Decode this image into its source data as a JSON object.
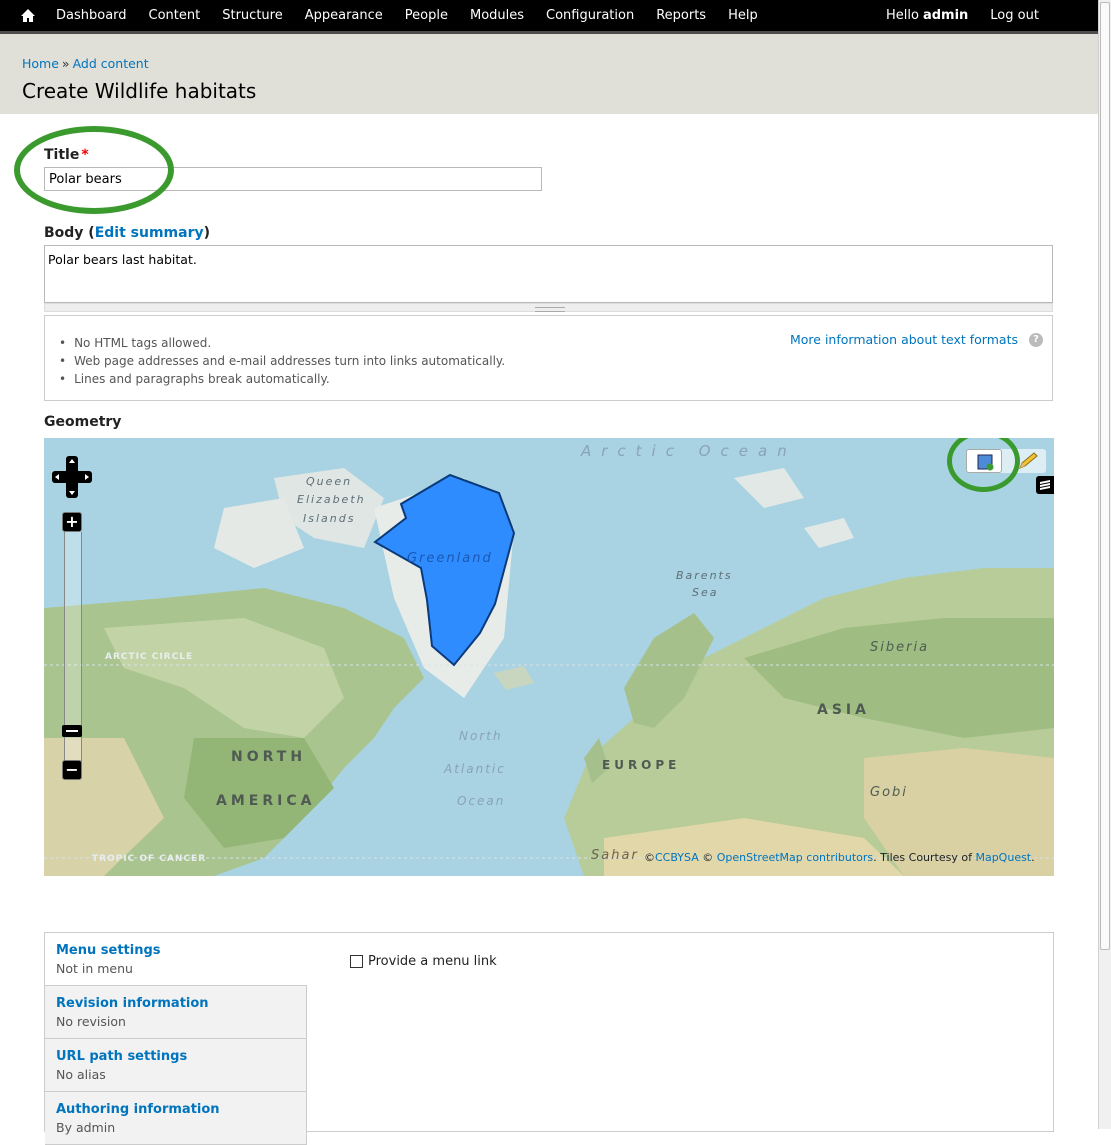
{
  "toolbar": {
    "menu": [
      "Dashboard",
      "Content",
      "Structure",
      "Appearance",
      "People",
      "Modules",
      "Configuration",
      "Reports",
      "Help"
    ],
    "greeting": "Hello",
    "username": "admin",
    "logout": "Log out"
  },
  "header": {
    "breadcrumb": [
      "Home",
      "Add content"
    ],
    "breadcrumb_sep": "»",
    "title": "Create Wildlife habitats"
  },
  "form": {
    "title_label": "Title",
    "required_mark": "*",
    "title_value": "Polar bears",
    "body_label": "Body",
    "edit_summary": "Edit summary",
    "body_value": "Polar bears last habitat.",
    "filter_tips": [
      "No HTML tags allowed.",
      "Web page addresses and e-mail addresses turn into links automatically.",
      "Lines and paragraphs break automatically."
    ],
    "more_info": "More information about text formats",
    "help_glyph": "?",
    "geometry_label": "Geometry"
  },
  "map": {
    "labels": {
      "arctic": "Arctic Ocean",
      "queen1": "Queen",
      "queen2": "Elizabeth",
      "queen3": "Islands",
      "greenland": "Greenland",
      "barents1": "Barents",
      "barents2": "Sea",
      "siberia": "Siberia",
      "arctic_circle": "ARCTIC CIRCLE",
      "asia": "ASIA",
      "north1": "North",
      "north2": "Atlantic",
      "north3": "Ocean",
      "europe": "EUROPE",
      "na1": "NORTH",
      "na2": "AMERICA",
      "gobi": "Gobi",
      "tropic": "TROPIC OF CANCER",
      "sahara": "Sahar"
    },
    "zoom_in": "+",
    "zoom_out": "−",
    "attribution": {
      "prefix": "©",
      "ccbysa": "CCBYSA",
      "sep": "© ",
      "osm": "OpenStreetMap contributors",
      "tiles": ". Tiles Courtesy of ",
      "mapquest": "MapQuest",
      "end": "."
    },
    "colors": {
      "polygon_fill": "#2f8cff",
      "polygon_stroke": "#0b3a7a",
      "annotation": "#3b9a2e"
    }
  },
  "vertical_tabs": [
    {
      "title": "Menu settings",
      "summary": "Not in menu"
    },
    {
      "title": "Revision information",
      "summary": "No revision"
    },
    {
      "title": "URL path settings",
      "summary": "No alias"
    },
    {
      "title": "Authoring information",
      "summary": "By admin"
    }
  ],
  "menu_link_label": "Provide a menu link"
}
